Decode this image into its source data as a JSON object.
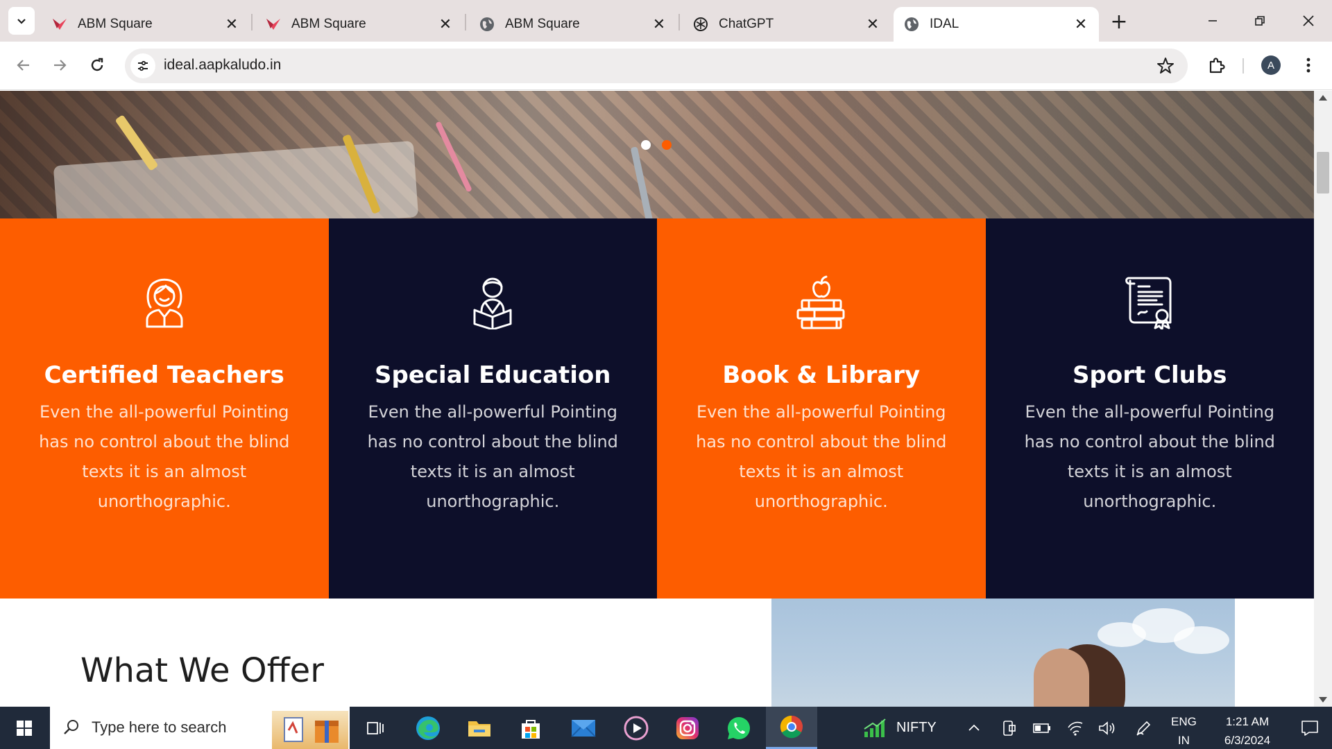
{
  "browser": {
    "tabs": [
      {
        "title": "ABM Square",
        "favicon": "abm-logo-icon",
        "active": false
      },
      {
        "title": "ABM Square",
        "favicon": "abm-logo-icon",
        "active": false
      },
      {
        "title": "ABM Square",
        "favicon": "globe-icon",
        "active": false
      },
      {
        "title": "ChatGPT",
        "favicon": "chatgpt-icon",
        "active": false
      },
      {
        "title": "IDAL",
        "favicon": "globe-icon",
        "active": true
      }
    ],
    "close_glyph": "✕",
    "new_tab_glyph": "+",
    "url": "ideal.aapkaludo.in",
    "profile_initial": "A"
  },
  "page": {
    "hero": {
      "slides": 2,
      "active_slide": 2
    },
    "features": [
      {
        "title": "Certified Teachers",
        "icon": "teacher-icon",
        "description": "Even the all-powerful Pointing has no control about the blind texts it is an almost unorthographic.",
        "bg": "#fd5d00"
      },
      {
        "title": "Special Education",
        "icon": "student-reading-icon",
        "description": "Even the all-powerful Pointing has no control about the blind texts it is an almost unorthographic.",
        "bg": "#0d0f2a"
      },
      {
        "title": "Book & Library",
        "icon": "books-apple-icon",
        "description": "Even the all-powerful Pointing has no control about the blind texts it is an almost unorthographic.",
        "bg": "#fd5d00"
      },
      {
        "title": "Sport Clubs",
        "icon": "certificate-icon",
        "description": "Even the all-powerful Pointing has no control about the blind texts it is an almost unorthographic.",
        "bg": "#0d0f2a"
      }
    ],
    "offer": {
      "title": "What We Offer"
    }
  },
  "taskbar": {
    "search_placeholder": "Type here to search",
    "apps": [
      "task-view-icon",
      "edge-icon",
      "file-explorer-icon",
      "microsoft-store-icon",
      "mail-icon",
      "media-player-icon",
      "instagram-icon",
      "whatsapp-icon",
      "chrome-icon"
    ],
    "ticker_label": "NIFTY",
    "language_line1": "ENG",
    "language_line2": "IN",
    "time": "1:21 AM",
    "date": "6/3/2024"
  },
  "colors": {
    "orange": "#fd5d00",
    "navy": "#0d0f2a",
    "dot_inactive": "#ffffff",
    "dot_active": "#fd5d00"
  }
}
